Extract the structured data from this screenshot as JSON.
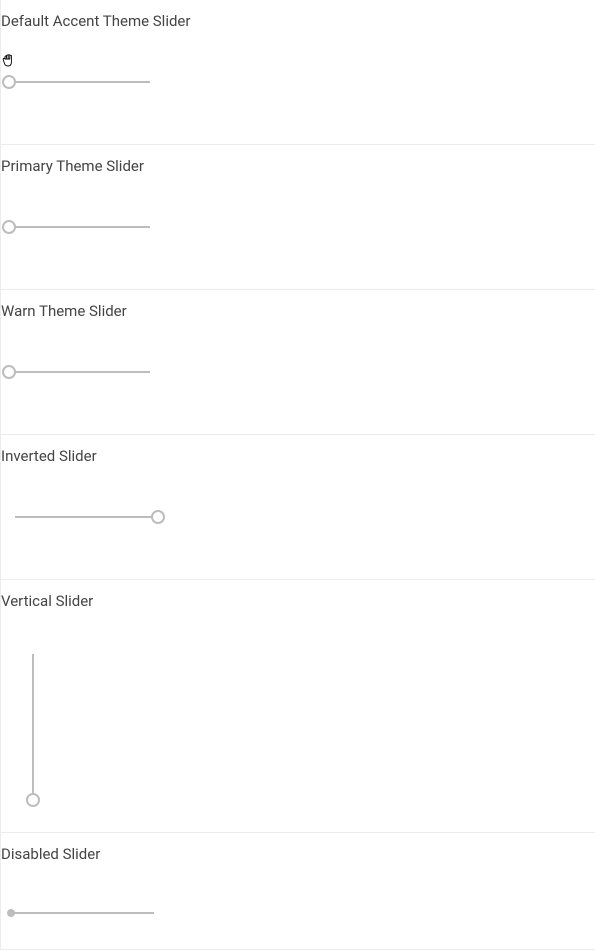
{
  "sections": {
    "accent": {
      "title": "Default Accent Theme Slider"
    },
    "primary": {
      "title": "Primary Theme Slider"
    },
    "warn": {
      "title": "Warn Theme Slider"
    },
    "inverted": {
      "title": "Inverted Slider"
    },
    "vertical": {
      "title": "Vertical Slider"
    },
    "disabled": {
      "title": "Disabled Slider"
    }
  }
}
